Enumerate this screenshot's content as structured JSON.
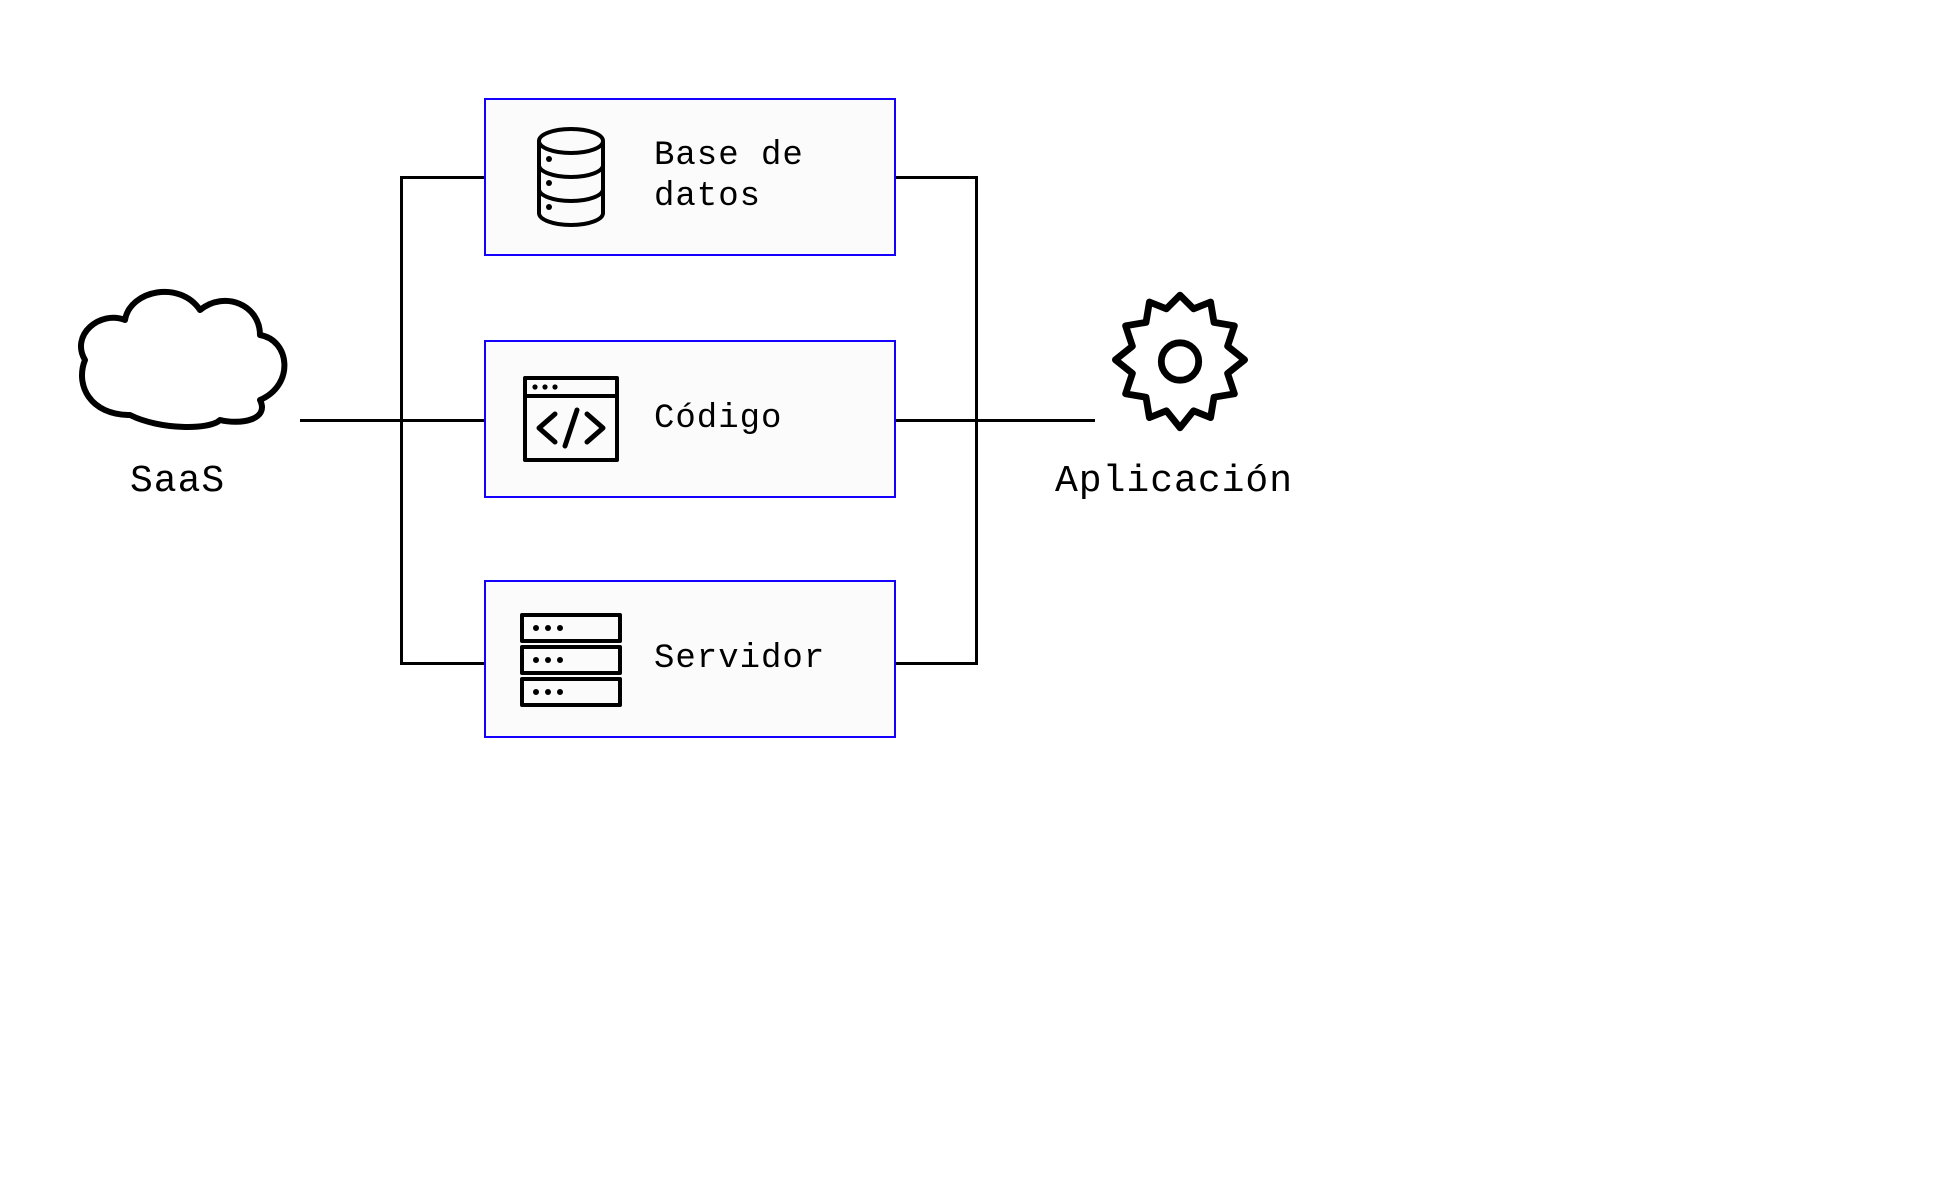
{
  "left_node": {
    "label": "SaaS"
  },
  "right_node": {
    "label": "Aplicación"
  },
  "boxes": {
    "db": {
      "label": "Base de\ndatos"
    },
    "code": {
      "label": "Código"
    },
    "server": {
      "label": "Servidor"
    }
  },
  "colors": {
    "box_border": "#1500ff",
    "stroke": "#000000",
    "bg": "#ffffff"
  }
}
